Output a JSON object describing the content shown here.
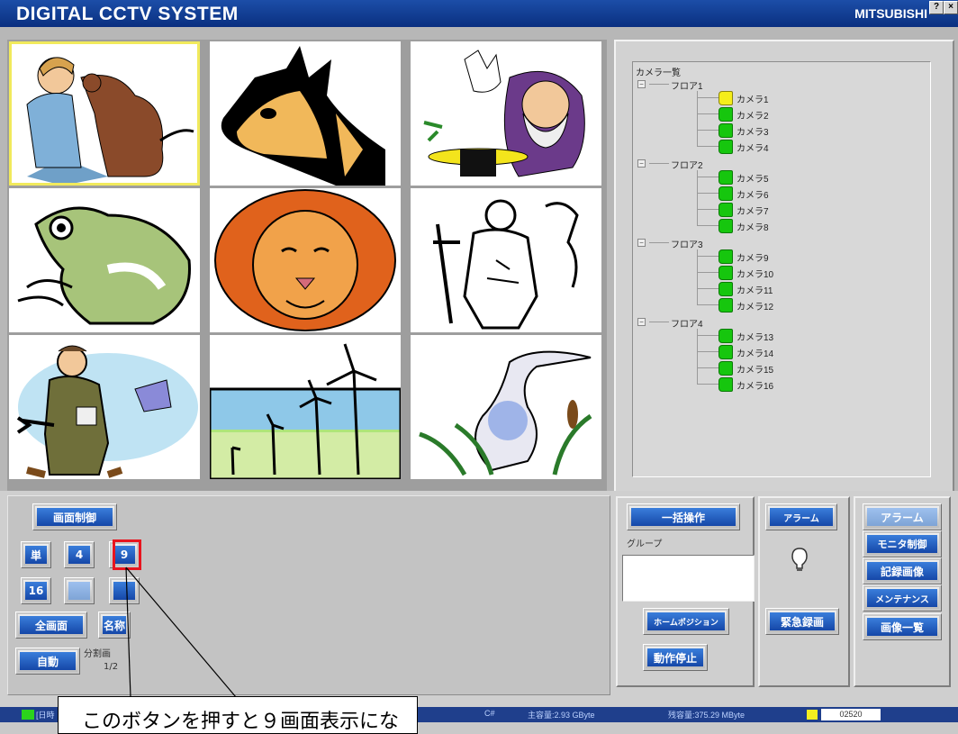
{
  "window": {
    "title": "DIGITAL CCTV SYSTEM",
    "brand": "MITSUBISHI",
    "help_button": "?",
    "close_button": "×"
  },
  "camera_grid": {
    "cells": [
      {
        "subject": "person-with-dog",
        "selected": true
      },
      {
        "subject": "horse-head",
        "selected": false
      },
      {
        "subject": "magician",
        "selected": false
      },
      {
        "subject": "frog",
        "selected": false
      },
      {
        "subject": "lion",
        "selected": false
      },
      {
        "subject": "hiker",
        "selected": false
      },
      {
        "subject": "mechanic",
        "selected": false
      },
      {
        "subject": "wind-turbines",
        "selected": false
      },
      {
        "subject": "heron",
        "selected": false
      }
    ]
  },
  "camera_tree": {
    "root_label": "カメラ一覧",
    "floors": [
      {
        "label": "フロア1",
        "cameras": [
          {
            "label": "カメラ1",
            "status": "yellow"
          },
          {
            "label": "カメラ2",
            "status": "green"
          },
          {
            "label": "カメラ3",
            "status": "green"
          },
          {
            "label": "カメラ4",
            "status": "green"
          }
        ]
      },
      {
        "label": "フロア2",
        "cameras": [
          {
            "label": "カメラ5",
            "status": "green"
          },
          {
            "label": "カメラ6",
            "status": "green"
          },
          {
            "label": "カメラ7",
            "status": "green"
          },
          {
            "label": "カメラ8",
            "status": "green"
          }
        ]
      },
      {
        "label": "フロア3",
        "cameras": [
          {
            "label": "カメラ9",
            "status": "green"
          },
          {
            "label": "カメラ10",
            "status": "green"
          },
          {
            "label": "カメラ11",
            "status": "green"
          },
          {
            "label": "カメラ12",
            "status": "green"
          }
        ]
      },
      {
        "label": "フロア4",
        "cameras": [
          {
            "label": "カメラ13",
            "status": "green"
          },
          {
            "label": "カメラ14",
            "status": "green"
          },
          {
            "label": "カメラ15",
            "status": "green"
          },
          {
            "label": "カメラ16",
            "status": "green"
          }
        ]
      }
    ]
  },
  "screen_control": {
    "title_button": "画面制御",
    "single": "単",
    "quad": "4",
    "nine": "9",
    "sixteen": "16",
    "disabled_mid": "",
    "split_right": "",
    "fullscreen": "全画面",
    "name": "名称",
    "auto": "自動",
    "split_label": "分割画",
    "page": "1/2"
  },
  "batch": {
    "header_button": "一括操作",
    "group_label": "グループ",
    "home_position": "ホームポジション",
    "stop_operation": "動作停止"
  },
  "alarm_panel": {
    "alarm_button": "アラーム",
    "emergency_record": "緊急録画"
  },
  "menu": {
    "alarm": "アラーム",
    "monitor_control": "モニタ制御",
    "recorded_images": "記録画像",
    "maintenance": "メンテナンス",
    "image_list": "画像一覧"
  },
  "status_bar": {
    "left_text": "[日時",
    "mid_left": "C#",
    "capacity_main": "主容量:2.93 GByte",
    "capacity_rest": "残容量:375.29 MByte",
    "counter": "02520"
  },
  "callout": {
    "text": "このボタンを押すと９画面表示にな"
  },
  "colors": {
    "title_bg": "#0a2f80",
    "camera_ok": "#16c60e",
    "camera_selected": "#f5ee1a",
    "highlight": "#e8151e",
    "button_blue": "#1547a8"
  }
}
